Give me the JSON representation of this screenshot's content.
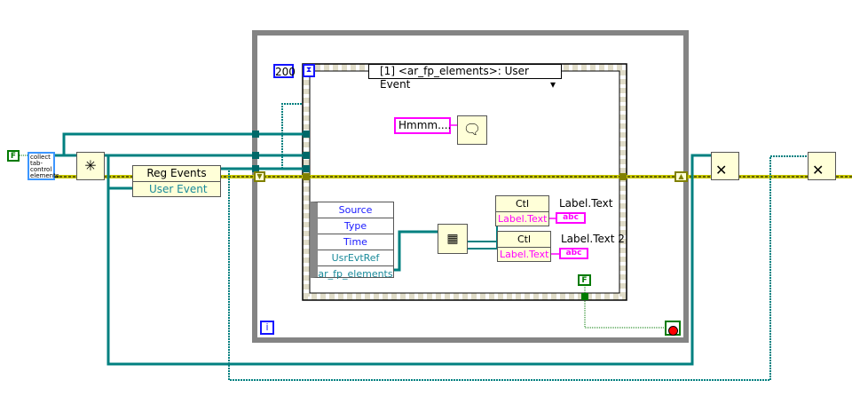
{
  "constants": {
    "false1": "F",
    "false2": "F",
    "timeout": "200",
    "message": "Hmmm...."
  },
  "control_label": "collect tab-control elements",
  "reg_events": {
    "title": "Reg Events",
    "event": "User Event"
  },
  "event_case": {
    "selector": "[1] <ar_fp_elements>: User Event"
  },
  "event_data": [
    "Source",
    "Type",
    "Time",
    "UsrEvtRef",
    "ar_fp_elements"
  ],
  "property_nodes": [
    {
      "class": "Ctl",
      "property": "Label.Text",
      "indicator": "Label.Text",
      "indicator_glyph": "abc"
    },
    {
      "class": "Ctl",
      "property": "Label.Text",
      "indicator": "Label.Text 2",
      "indicator_glyph": "abc"
    }
  ],
  "loop_index": "i",
  "colors": {
    "refwire": "#008080",
    "error": "#c8c800",
    "string": "#ff00ff",
    "bool": "#007a00",
    "loop": "#848484"
  }
}
